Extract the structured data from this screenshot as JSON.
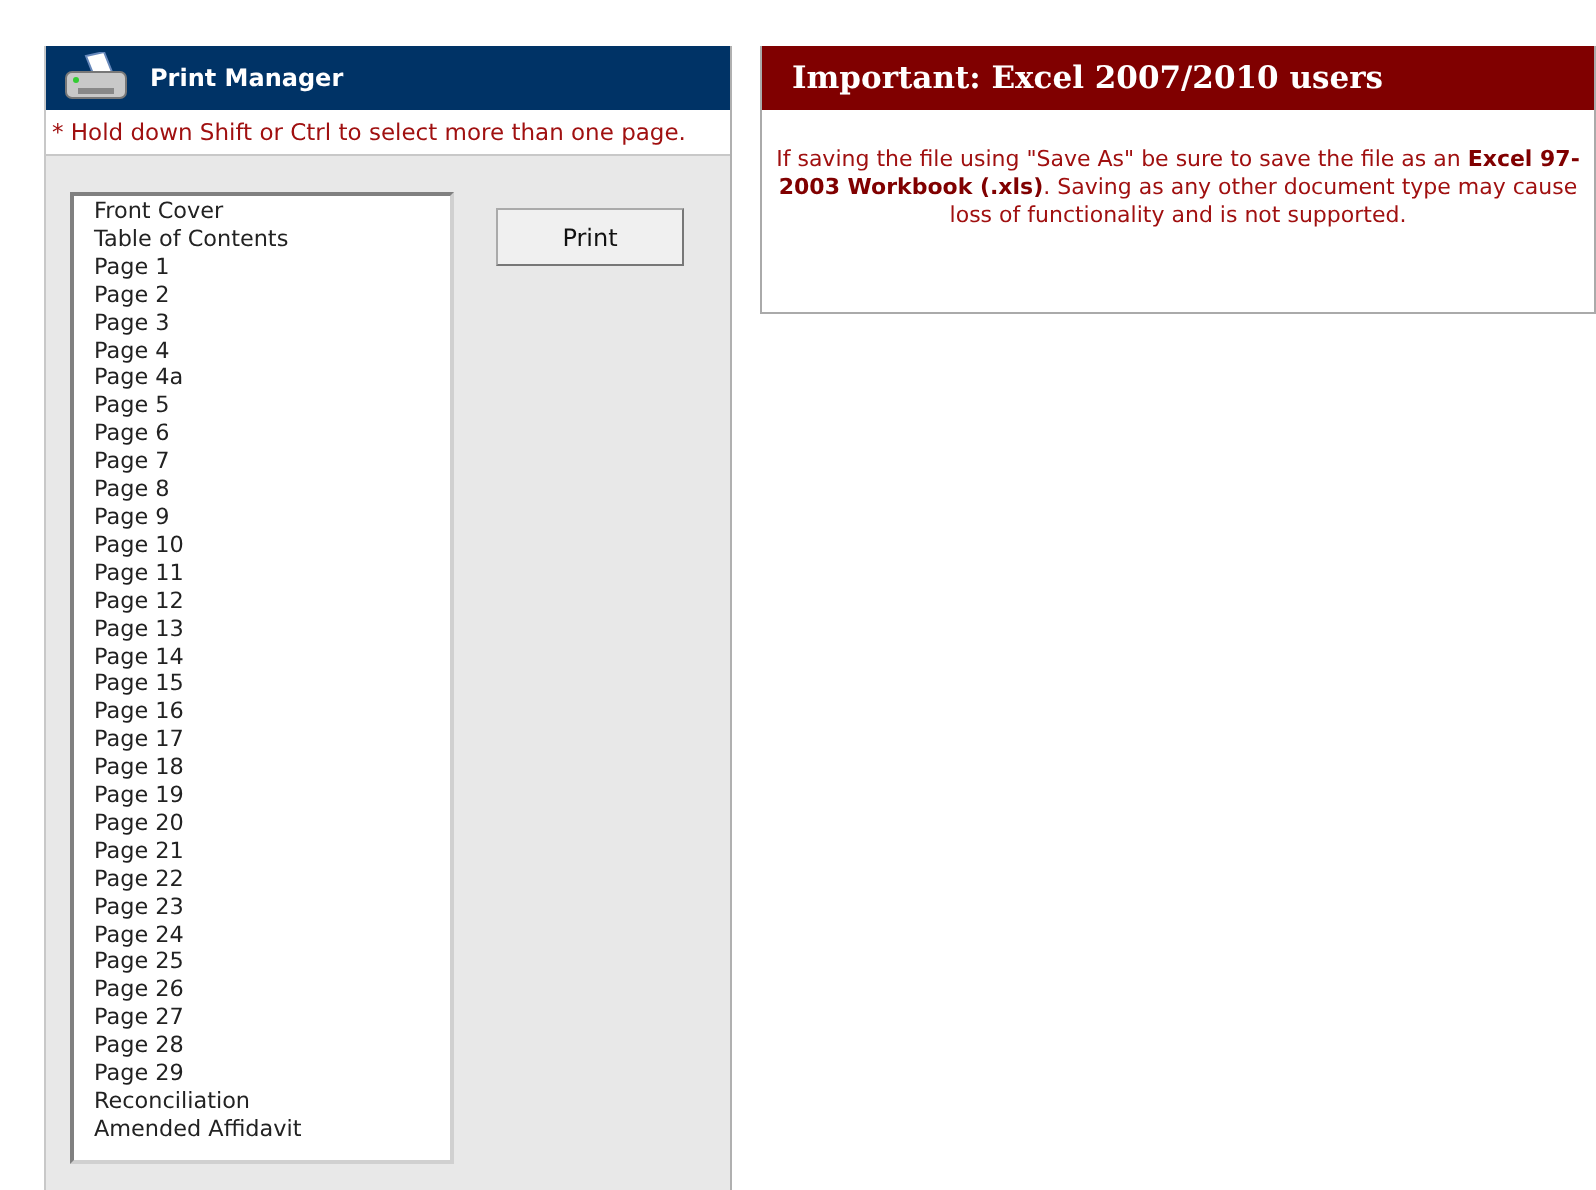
{
  "print_manager": {
    "title": "Print Manager",
    "hint": "* Hold down Shift or Ctrl to select more than one page.",
    "pages": [
      "Front Cover",
      "Table of Contents",
      "Page 1",
      "Page 2",
      "Page 3",
      "Page 4",
      "Page 4a",
      "Page 5",
      "Page 6",
      "Page 7",
      "Page 8",
      "Page 9",
      "Page 10",
      "Page 11",
      "Page 12",
      "Page 13",
      "Page 14",
      "Page 15",
      "Page 16",
      "Page 17",
      "Page 18",
      "Page 19",
      "Page 20",
      "Page 21",
      "Page 22",
      "Page 23",
      "Page 24",
      "Page 25",
      "Page 26",
      "Page 27",
      "Page 28",
      "Page 29",
      "Reconciliation",
      "Amended Affidavit"
    ],
    "print_button": "Print"
  },
  "notice": {
    "title": "Important: Excel 2007/2010 users",
    "message": "If saving the file using \"Save As\" be sure to save the file as an **Excel 97-2003 Workbook (.xls)**. Saving as any other document type may cause loss of functionality and is not supported."
  }
}
